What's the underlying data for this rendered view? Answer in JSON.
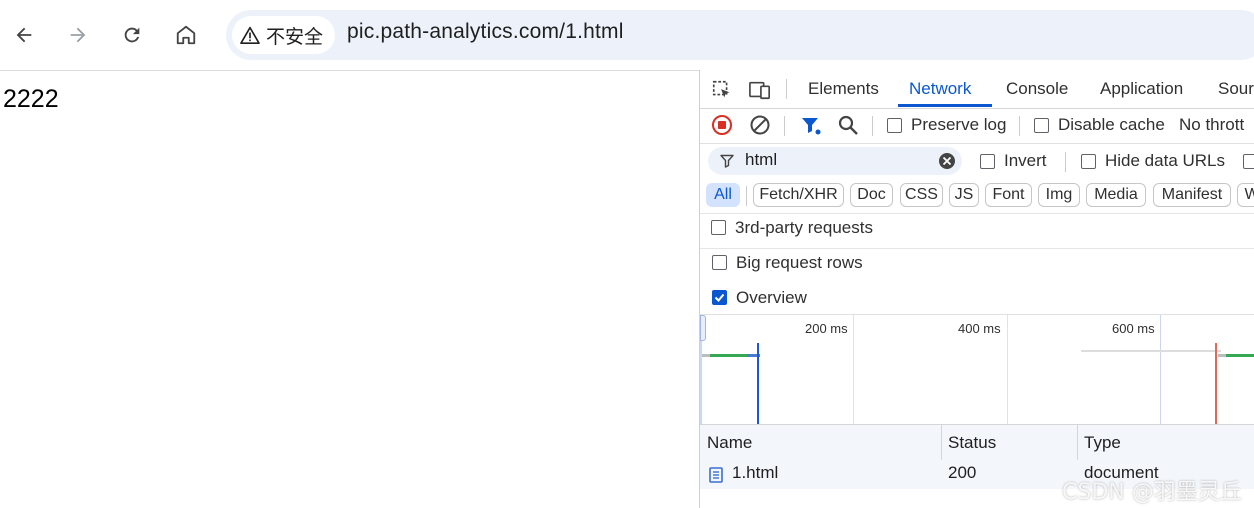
{
  "browser": {
    "back_icon": "arrow-left-icon",
    "forward_icon": "arrow-right-icon",
    "reload_icon": "reload-icon",
    "home_icon": "home-icon",
    "security_label": "不安全",
    "url": "pic.path-analytics.com/1.html"
  },
  "page": {
    "content": "2222"
  },
  "devtools": {
    "tabs": [
      "Elements",
      "Network",
      "Console",
      "Application",
      "Sour"
    ],
    "active_tab": "Network",
    "actions": {
      "preserve_log": "Preserve log",
      "disable_cache": "Disable cache",
      "throttling": "No thrott"
    },
    "filter": {
      "value": "html",
      "invert": "Invert",
      "hide_data_urls": "Hide data URLs"
    },
    "types": [
      "All",
      "Fetch/XHR",
      "Doc",
      "CSS",
      "JS",
      "Font",
      "Img",
      "Media",
      "Manifest",
      "W"
    ],
    "options": {
      "third_party": "3rd-party requests",
      "big_rows": "Big request rows",
      "overview": "Overview"
    },
    "overview_ticks": [
      "200 ms",
      "400 ms",
      "600 ms"
    ],
    "table": {
      "headers": [
        "Name",
        "Status",
        "Type"
      ],
      "rows": [
        {
          "name": "1.html",
          "status": "200",
          "type": "document"
        }
      ]
    },
    "colors": {
      "accent": "#0b57d0",
      "record": "#d93025",
      "active_chip_bg": "#d3e3fd"
    }
  },
  "watermark": "CSDN @羽墨灵丘"
}
